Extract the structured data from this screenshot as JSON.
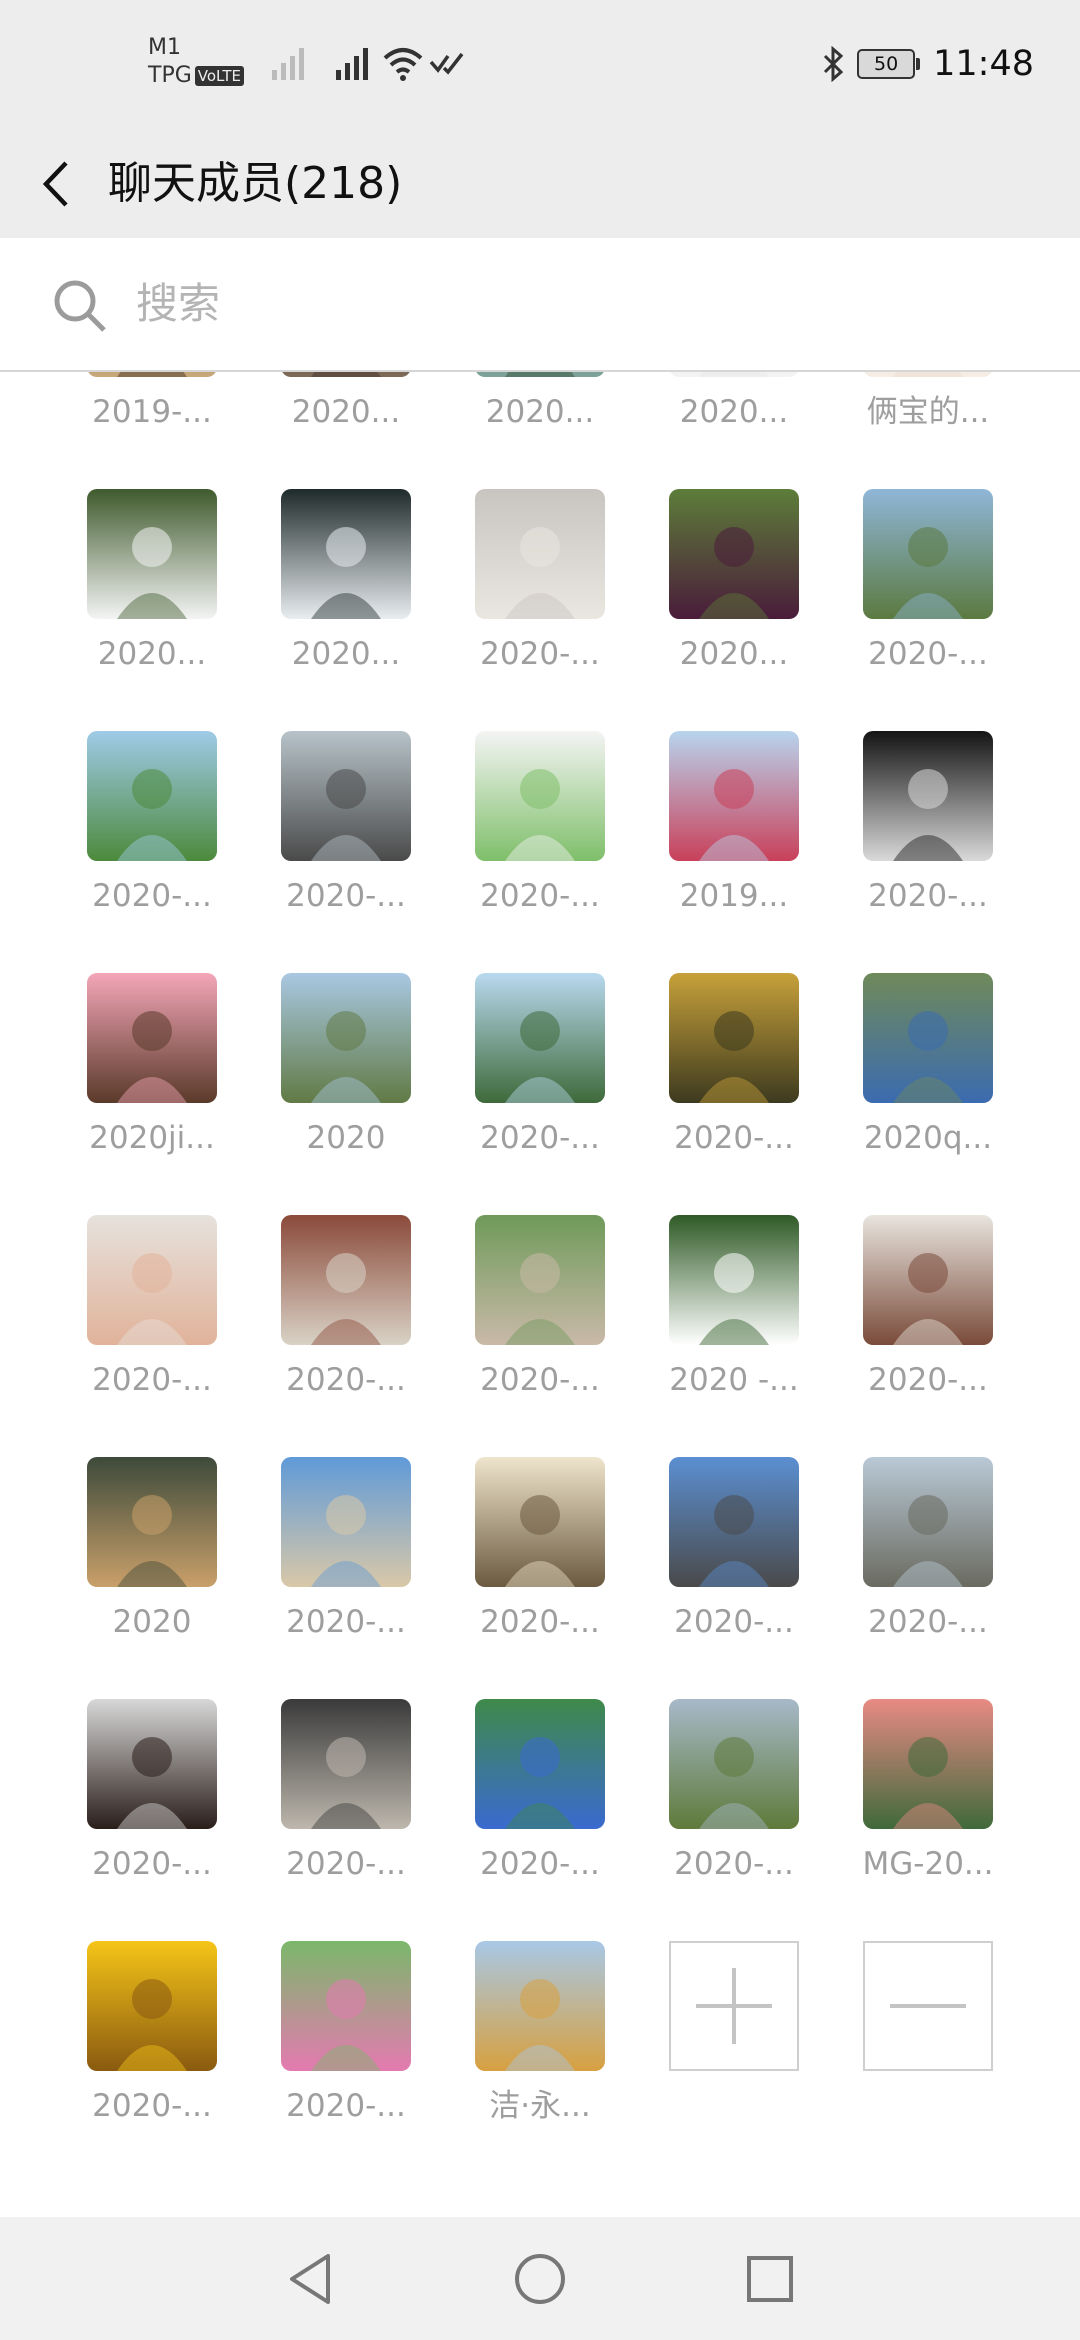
{
  "status": {
    "carrier_line1": "M1",
    "carrier_line2": "TPG",
    "volte": "VoLTE",
    "battery": "50",
    "time": "11:48"
  },
  "header": {
    "title": "聊天成员(218)"
  },
  "search": {
    "placeholder": "搜索"
  },
  "colors": {
    "bar_bg": "#ededed",
    "name_text": "#9e9e9e",
    "divider": "#d6d6d6"
  },
  "members": [
    {
      "name": "2019-...",
      "icon": "avatar-photo",
      "c1": "#3a2b1f",
      "c2": "#c9a97a"
    },
    {
      "name": "2020...",
      "icon": "avatar-photo",
      "c1": "#3b2f27",
      "c2": "#7e6a58"
    },
    {
      "name": "2020...",
      "icon": "avatar-photo",
      "c1": "#2f4a34",
      "c2": "#7fa39a"
    },
    {
      "name": "2020...",
      "icon": "avatar-photo",
      "c1": "#e9e9e9",
      "c2": "#f3f3f3"
    },
    {
      "name": "俩宝的...",
      "icon": "avatar-photo",
      "c1": "#eadbcf",
      "c2": "#f6ede4"
    },
    {
      "name": "2020...",
      "icon": "panda-photo",
      "c1": "#3f5a2d",
      "c2": "#f4f4f4"
    },
    {
      "name": "2020...",
      "icon": "egret-photo",
      "c1": "#1f2a2a",
      "c2": "#e8edf0"
    },
    {
      "name": "2020-...",
      "icon": "pottery-photo",
      "c1": "#c8c4c0",
      "c2": "#eae6e0"
    },
    {
      "name": "2020...",
      "icon": "orchid-photo",
      "c1": "#5d7d3a",
      "c2": "#4a1c3a"
    },
    {
      "name": "2020-...",
      "icon": "landscape-photo",
      "c1": "#8fb6d8",
      "c2": "#5b7a40"
    },
    {
      "name": "2020-...",
      "icon": "lake-photo",
      "c1": "#9fcbe8",
      "c2": "#4c8a3c"
    },
    {
      "name": "2020-...",
      "icon": "man-photo",
      "c1": "#b7c3c9",
      "c2": "#4a4a4a"
    },
    {
      "name": "2020-...",
      "icon": "sprout-photo",
      "c1": "#f4f4f4",
      "c2": "#7fbf6a"
    },
    {
      "name": "2019...",
      "icon": "woman-photo",
      "c1": "#b8d4ee",
      "c2": "#c9405a"
    },
    {
      "name": "2020-...",
      "icon": "statue-photo",
      "c1": "#141414",
      "c2": "#d9d9d9"
    },
    {
      "name": "2020ji...",
      "icon": "cartoon-girl-photo",
      "c1": "#f4a6b8",
      "c2": "#5a3a2a"
    },
    {
      "name": "2020",
      "icon": "hill-photo",
      "c1": "#a9c8e2",
      "c2": "#617a45"
    },
    {
      "name": "2020-...",
      "icon": "karst-photo",
      "c1": "#b9d9ef",
      "c2": "#3e6a3a"
    },
    {
      "name": "2020-...",
      "icon": "stream-photo",
      "c1": "#c7a13a",
      "c2": "#3d3a1f"
    },
    {
      "name": "2020q...",
      "icon": "woman-dress-photo",
      "c1": "#6f8a5a",
      "c2": "#3b6bb0"
    },
    {
      "name": "2020-...",
      "icon": "selfie-photo",
      "c1": "#e6e1dc",
      "c2": "#e1b39a"
    },
    {
      "name": "2020-...",
      "icon": "building-photo",
      "c1": "#8b4a3a",
      "c2": "#d9d2c6"
    },
    {
      "name": "2020-...",
      "icon": "girl-back-photo",
      "c1": "#6f9a5a",
      "c2": "#c9b9a8"
    },
    {
      "name": "2020 -...",
      "icon": "flower-photo",
      "c1": "#2f5a26",
      "c2": "#ffffff"
    },
    {
      "name": "2020-...",
      "icon": "family-photo",
      "c1": "#e8e4de",
      "c2": "#7a4b3a"
    },
    {
      "name": "2020",
      "icon": "kitten-photo",
      "c1": "#3d4a3a",
      "c2": "#c9a06a"
    },
    {
      "name": "2020-...",
      "icon": "beach-jump-photo",
      "c1": "#5f9ad8",
      "c2": "#d9c8a8"
    },
    {
      "name": "2020-...",
      "icon": "sketch-photo",
      "c1": "#efe5cc",
      "c2": "#6b5a40"
    },
    {
      "name": "2020-...",
      "icon": "aircraft-photo",
      "c1": "#5b8fd1",
      "c2": "#4a4a4a"
    },
    {
      "name": "2020-...",
      "icon": "seaside-photo",
      "c1": "#b9c9d6",
      "c2": "#6a6a60"
    },
    {
      "name": "2020-...",
      "icon": "woman-face-photo",
      "c1": "#d8d8d8",
      "c2": "#2a1e1a"
    },
    {
      "name": "2020-...",
      "icon": "stairs-photo",
      "c1": "#3a3a3a",
      "c2": "#bdb7ad"
    },
    {
      "name": "2020-...",
      "icon": "starfish-photo",
      "c1": "#3f8a4a",
      "c2": "#3a6ad0"
    },
    {
      "name": "2020-...",
      "icon": "coast-photo",
      "c1": "#a7b9c9",
      "c2": "#5f7a3a"
    },
    {
      "name": "MG-20...",
      "icon": "flowers-photo",
      "c1": "#e88a84",
      "c2": "#3f6a3a"
    },
    {
      "name": "2020-...",
      "icon": "sunflower-photo",
      "c1": "#f5c518",
      "c2": "#8a5a10"
    },
    {
      "name": "2020-...",
      "icon": "lotus-photo",
      "c1": "#7ab86a",
      "c2": "#e47ab0"
    },
    {
      "name": "洁·永...",
      "icon": "castle-photo",
      "c1": "#a8c8e6",
      "c2": "#d7a040"
    }
  ],
  "actions": {
    "add_icon": "plus-icon",
    "remove_icon": "minus-icon"
  }
}
